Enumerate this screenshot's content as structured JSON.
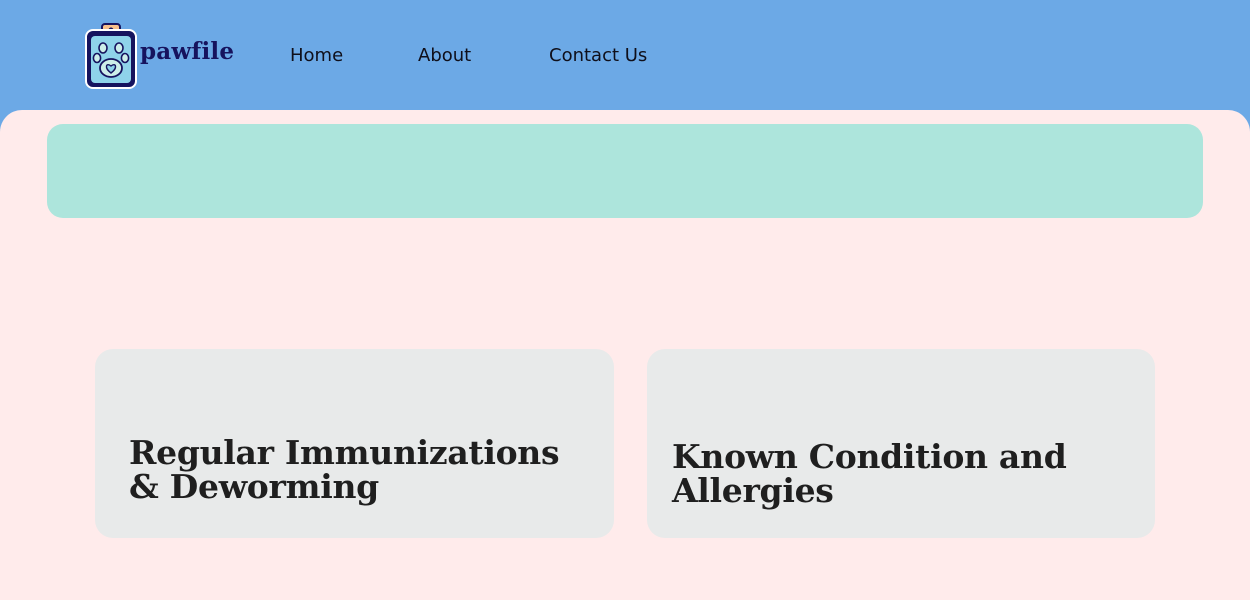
{
  "brand": {
    "name": "pawfile",
    "logo_icon": "clipboard-paw-icon",
    "colors": {
      "header_bg": "#6ca9e6",
      "page_bg": "#ffebeb",
      "banner_bg": "#ade5dc",
      "card_bg": "#e8eaea",
      "brand_text": "#16135e"
    }
  },
  "nav": {
    "items": [
      {
        "label": "Home"
      },
      {
        "label": "About"
      },
      {
        "label": "Contact Us"
      }
    ]
  },
  "cards": [
    {
      "title": "Regular Immunizations & Deworming"
    },
    {
      "title": "Known Condition and Allergies"
    }
  ]
}
